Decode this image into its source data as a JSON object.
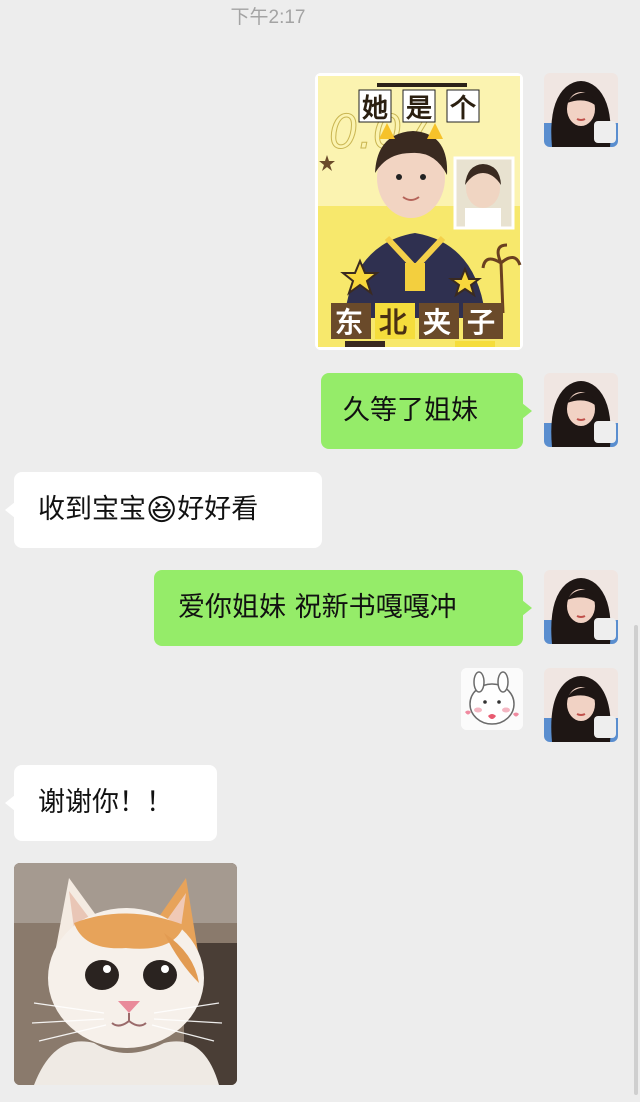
{
  "timestamp": "下午2:17",
  "messages": [
    {
      "side": "right",
      "type": "image",
      "content": "poster",
      "alt_parts": [
        "她",
        "是",
        "个",
        "东",
        "北",
        "夹",
        "子"
      ]
    },
    {
      "side": "right",
      "type": "text",
      "text": "久等了姐妹"
    },
    {
      "side": "left",
      "type": "text",
      "text_before": "收到宝宝",
      "emoji": "😆",
      "text_after": "好好看"
    },
    {
      "side": "right",
      "type": "text",
      "text": "爱你姐妹 祝新书嘎嘎冲"
    },
    {
      "side": "right",
      "type": "sticker",
      "content": "bunny-sticker"
    },
    {
      "side": "left",
      "type": "text",
      "text": "谢谢你！！"
    },
    {
      "side": "left",
      "type": "image",
      "content": "cat-photo"
    }
  ],
  "poster": {
    "title_top": [
      "她",
      "是",
      "个"
    ],
    "title_bottom": [
      "东",
      "北",
      "夹",
      "子"
    ],
    "bg_number": "0.07",
    "accent_color": "#f5dd3c"
  },
  "colors": {
    "chat_bg": "#ededed",
    "bubble_green": "#95ec69",
    "bubble_white": "#ffffff",
    "timestamp": "#a3a3a3"
  },
  "icons": {
    "avatar": "user-avatar-photo",
    "sticker": "bunny-heart-sticker"
  }
}
